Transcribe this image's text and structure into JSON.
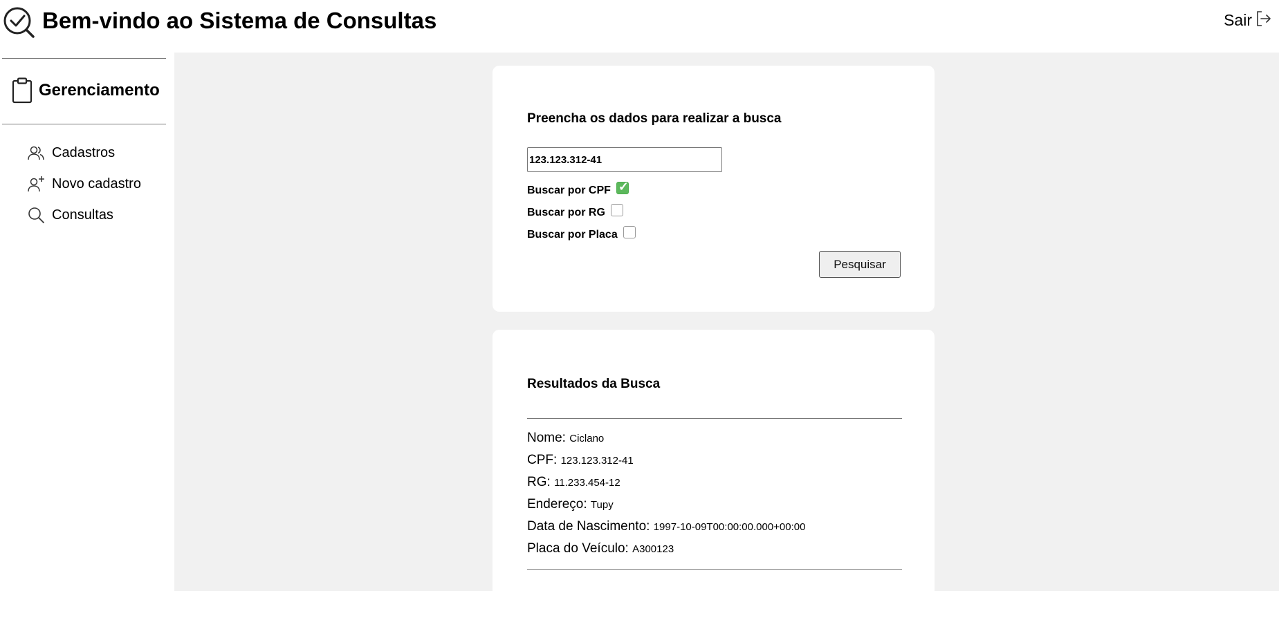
{
  "header": {
    "title": "Bem-vindo ao Sistema de Consultas",
    "logout_label": "Sair"
  },
  "sidebar": {
    "section_title": "Gerenciamento",
    "items": [
      {
        "label": "Cadastros",
        "icon": "users-icon"
      },
      {
        "label": "Novo cadastro",
        "icon": "user-plus-icon"
      },
      {
        "label": "Consultas",
        "icon": "search-icon"
      }
    ]
  },
  "search_form": {
    "heading": "Preencha os dados para realizar a busca",
    "input_value": "123.123.312-41",
    "options": [
      {
        "label": "Buscar por CPF",
        "checked": true
      },
      {
        "label": "Buscar por RG",
        "checked": false
      },
      {
        "label": "Buscar por Placa",
        "checked": false
      }
    ],
    "submit_label": "Pesquisar"
  },
  "results": {
    "heading": "Resultados da Busca",
    "fields": [
      {
        "label": "Nome:",
        "value": "Ciclano"
      },
      {
        "label": "CPF:",
        "value": "123.123.312-41"
      },
      {
        "label": "RG:",
        "value": "11.233.454-12"
      },
      {
        "label": "Endereço:",
        "value": "Tupy"
      },
      {
        "label": "Data de Nascimento:",
        "value": "1997-10-09T00:00:00.000+00:00"
      },
      {
        "label": "Placa do Veículo:",
        "value": "A300123"
      }
    ]
  },
  "colors": {
    "checkbox_checked": "#5cb85c",
    "main_background": "#f1f1f1"
  }
}
